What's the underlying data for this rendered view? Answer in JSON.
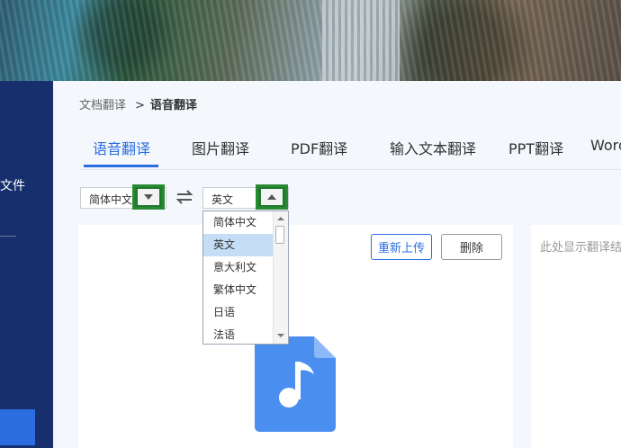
{
  "sidebar": {
    "partial_label": "文件"
  },
  "breadcrumb": {
    "parent": "文档翻译",
    "separator": ">",
    "current": "语音翻译"
  },
  "tabs": [
    {
      "label": "语音翻译",
      "active": true
    },
    {
      "label": "图片翻译",
      "active": false
    },
    {
      "label": "PDF翻译",
      "active": false
    },
    {
      "label": "输入文本翻译",
      "active": false
    },
    {
      "label": "PPT翻译",
      "active": false
    },
    {
      "label": "Word",
      "active": false
    }
  ],
  "source_language": {
    "value": "简体中文"
  },
  "target_language": {
    "value": "英文"
  },
  "language_options": [
    {
      "label": "简体中文",
      "selected": false
    },
    {
      "label": "英文",
      "selected": true
    },
    {
      "label": "意大利文",
      "selected": false
    },
    {
      "label": "繁体中文",
      "selected": false
    },
    {
      "label": "日语",
      "selected": false
    },
    {
      "label": "法语",
      "selected": false
    }
  ],
  "upload_panel": {
    "reupload_label": "重新上传",
    "delete_label": "删除",
    "file_icon": "music-file-icon"
  },
  "result_panel": {
    "placeholder": "此处显示翻译结"
  },
  "colors": {
    "accent": "#2b6de0",
    "sidebar": "#17306d",
    "highlight_button": "#1f7a2e",
    "file_icon": "#4a8ef0"
  }
}
